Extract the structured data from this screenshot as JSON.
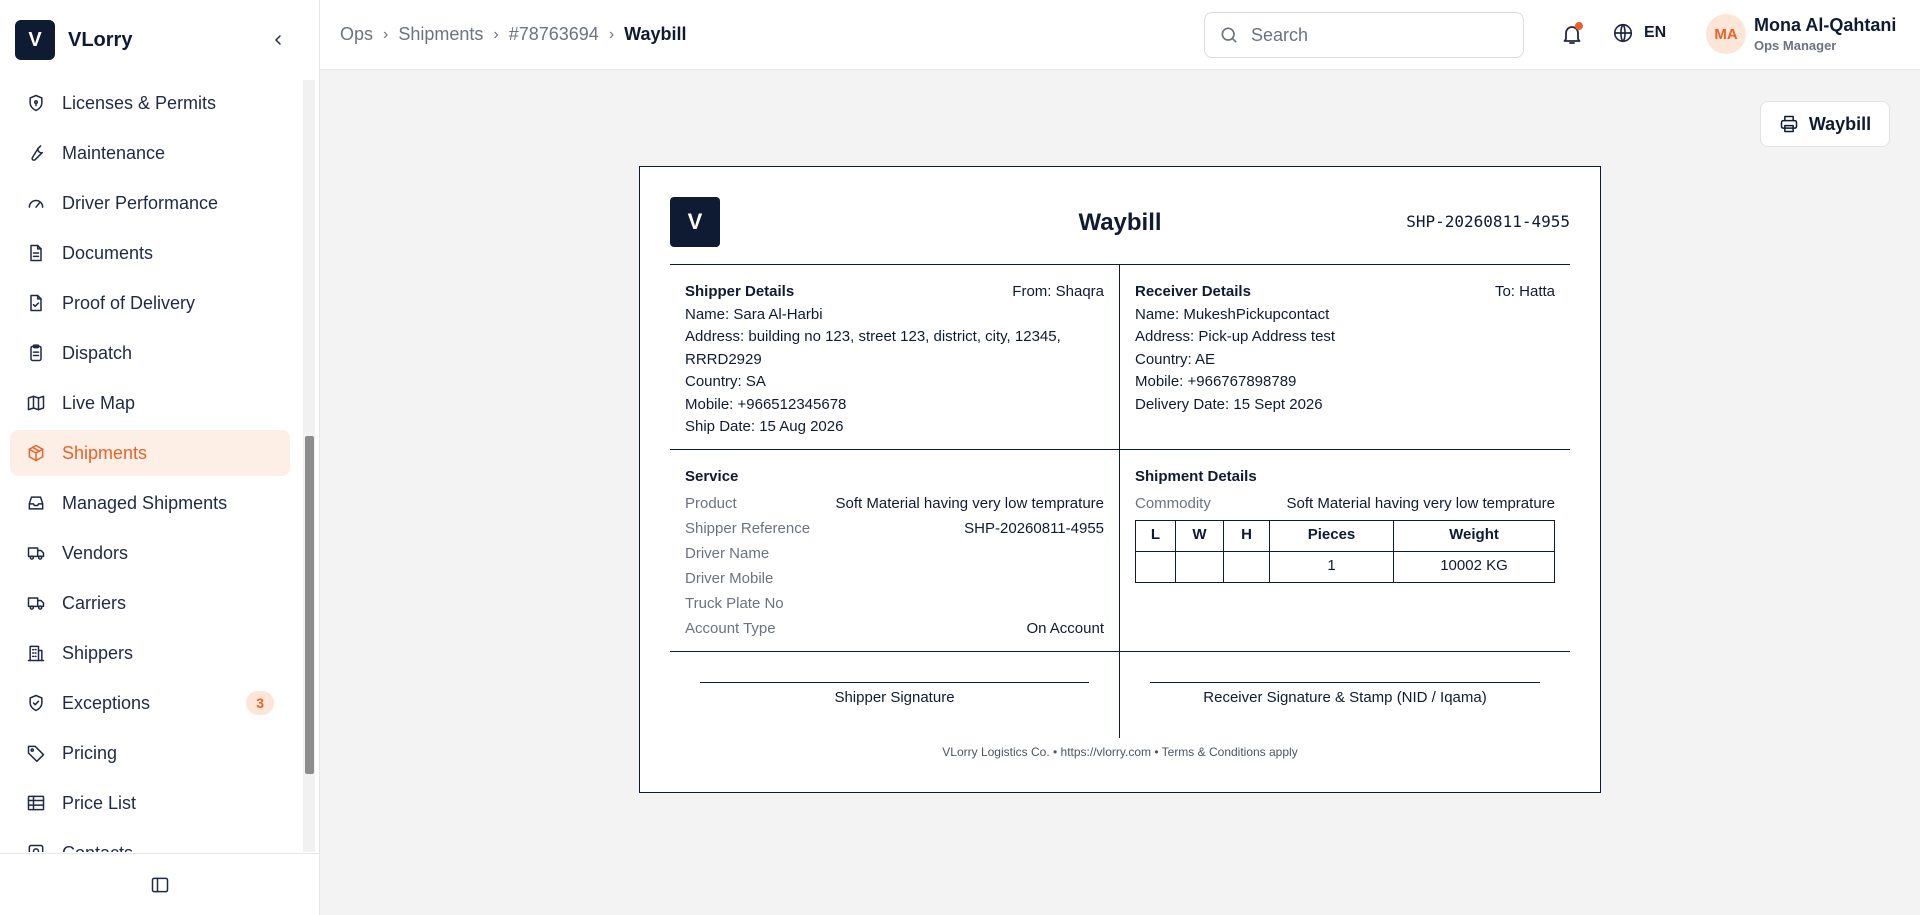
{
  "brand": {
    "logo_letter": "V",
    "name": "VLorry"
  },
  "sidebar": {
    "items": [
      {
        "label": "Licenses & Permits",
        "icon": "shield-icon"
      },
      {
        "label": "Maintenance",
        "icon": "wrench-icon"
      },
      {
        "label": "Driver Performance",
        "icon": "gauge-icon"
      },
      {
        "label": "Documents",
        "icon": "document-icon"
      },
      {
        "label": "Proof of Delivery",
        "icon": "document-check-icon"
      },
      {
        "label": "Dispatch",
        "icon": "clipboard-icon"
      },
      {
        "label": "Live Map",
        "icon": "map-icon"
      },
      {
        "label": "Shipments",
        "icon": "package-icon",
        "active": true
      },
      {
        "label": "Managed Shipments",
        "icon": "inbox-icon"
      },
      {
        "label": "Vendors",
        "icon": "truck-icon"
      },
      {
        "label": "Carriers",
        "icon": "truck-icon"
      },
      {
        "label": "Shippers",
        "icon": "building-icon"
      },
      {
        "label": "Exceptions",
        "icon": "shield-check-icon",
        "badge": "3"
      },
      {
        "label": "Pricing",
        "icon": "tag-icon"
      },
      {
        "label": "Price List",
        "icon": "table-icon"
      },
      {
        "label": "Contacts",
        "icon": "contacts-icon"
      }
    ]
  },
  "header": {
    "breadcrumb": [
      "Ops",
      "Shipments",
      "#78763694",
      "Waybill"
    ],
    "search_placeholder": "Search",
    "language": "EN",
    "user": {
      "initials": "MA",
      "name": "Mona Al-Qahtani",
      "role": "Ops Manager"
    }
  },
  "actions": {
    "print_label": "Waybill"
  },
  "waybill": {
    "logo_letter": "V",
    "title": "Waybill",
    "shipment_id": "SHP-20260811-4955",
    "shipper": {
      "title": "Shipper Details",
      "from": "From: Shaqra",
      "name": "Name: Sara Al-Harbi",
      "address": "Address: building no 123, street 123, district, city, 12345, RRRD2929",
      "country": "Country: SA",
      "mobile": "Mobile: +966512345678",
      "ship_date": "Ship Date: 15 Aug 2026"
    },
    "receiver": {
      "title": "Receiver Details",
      "to": "To: Hatta",
      "name": "Name: MukeshPickupcontact",
      "address": "Address: Pick-up Address test",
      "country": "Country: AE",
      "mobile": "Mobile: +966767898789",
      "delivery_date": "Delivery Date: 15 Sept 2026"
    },
    "service": {
      "title": "Service",
      "rows": [
        {
          "k": "Product",
          "v": "Soft Material having very low temprature"
        },
        {
          "k": "Shipper Reference",
          "v": "SHP-20260811-4955"
        },
        {
          "k": "Driver Name",
          "v": ""
        },
        {
          "k": "Driver Mobile",
          "v": ""
        },
        {
          "k": "Truck Plate No",
          "v": ""
        },
        {
          "k": "Account Type",
          "v": "On Account"
        }
      ]
    },
    "shipment_details": {
      "title": "Shipment Details",
      "commodity_label": "Commodity",
      "commodity_value": "Soft Material having very low temprature",
      "columns": [
        "L",
        "W",
        "H",
        "Pieces",
        "Weight"
      ],
      "row": [
        "",
        "",
        "",
        "1",
        "10002 KG"
      ]
    },
    "signatures": {
      "shipper": "Shipper Signature",
      "receiver": "Receiver Signature & Stamp (NID / Iqama)"
    },
    "footer": "VLorry Logistics Co. • https://vlorry.com • Terms & Conditions apply"
  }
}
